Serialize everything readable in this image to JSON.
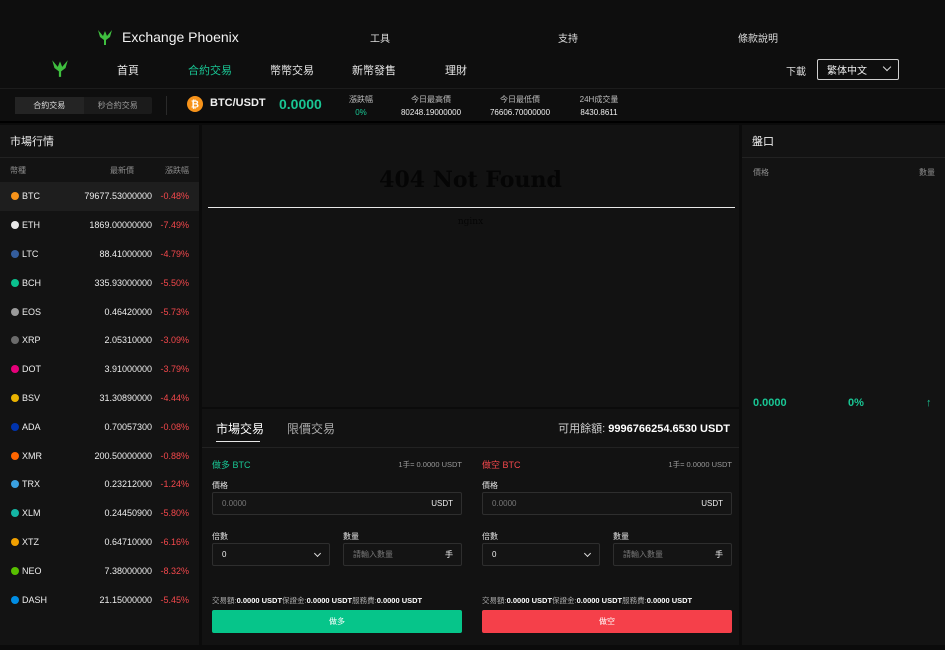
{
  "header": {
    "brand": "Exchange Phoenix",
    "top_links": [
      "工具",
      "支持",
      "條款說明"
    ],
    "nav": [
      "首頁",
      "合約交易",
      "幣幣交易",
      "新幣發售",
      "理財"
    ],
    "active_nav": "合約交易",
    "download": "下載",
    "language": "繁体中文"
  },
  "ticker": {
    "mode_tabs": [
      "合約交易",
      "秒合約交易"
    ],
    "pair": "BTC/USDT",
    "price": "0.0000",
    "change_label": "漲跌幅",
    "change_value": "0%",
    "high_label": "今日最高價",
    "high_value": "80248.19000000",
    "low_label": "今日最低價",
    "low_value": "76606.70000000",
    "vol_label": "24H成交量",
    "vol_value": "8430.8611"
  },
  "market": {
    "title": "市場行情",
    "col_coin": "幣種",
    "col_price": "最新價",
    "col_change": "漲跌幅",
    "rows": [
      {
        "sym": "BTC",
        "price": "79677.53000000",
        "change": "-0.48%",
        "color": "#f7931a"
      },
      {
        "sym": "ETH",
        "price": "1869.00000000",
        "change": "-7.49%",
        "color": "#e8e8e8"
      },
      {
        "sym": "LTC",
        "price": "88.41000000",
        "change": "-4.79%",
        "color": "#345d9d"
      },
      {
        "sym": "BCH",
        "price": "335.93000000",
        "change": "-5.50%",
        "color": "#0ac18e"
      },
      {
        "sym": "EOS",
        "price": "0.46420000",
        "change": "-5.73%",
        "color": "#9a9a9a"
      },
      {
        "sym": "XRP",
        "price": "2.05310000",
        "change": "-3.09%",
        "color": "#6b6b6b"
      },
      {
        "sym": "DOT",
        "price": "3.91000000",
        "change": "-3.79%",
        "color": "#e6007a"
      },
      {
        "sym": "BSV",
        "price": "31.30890000",
        "change": "-4.44%",
        "color": "#eab300"
      },
      {
        "sym": "ADA",
        "price": "0.70057300",
        "change": "-0.08%",
        "color": "#0033ad"
      },
      {
        "sym": "XMR",
        "price": "200.50000000",
        "change": "-0.88%",
        "color": "#ff6600"
      },
      {
        "sym": "TRX",
        "price": "0.23212000",
        "change": "-1.24%",
        "color": "#3aa0e0"
      },
      {
        "sym": "XLM",
        "price": "0.24450900",
        "change": "-5.80%",
        "color": "#14b6a4"
      },
      {
        "sym": "XTZ",
        "price": "0.64710000",
        "change": "-6.16%",
        "color": "#f0a000"
      },
      {
        "sym": "NEO",
        "price": "7.38000000",
        "change": "-8.32%",
        "color": "#58bf00"
      },
      {
        "sym": "DASH",
        "price": "21.15000000",
        "change": "-5.45%",
        "color": "#008de4"
      }
    ]
  },
  "chart_area": {
    "error_title": "404 Not Found",
    "error_sub": "nginx"
  },
  "order": {
    "tabs": [
      "市場交易",
      "限價交易"
    ],
    "available_label": "可用餘額:",
    "available_value": "9996766254.6530 USDT",
    "buy": {
      "side": "做多 BTC",
      "unit_info": "1手= 0.0000 USDT",
      "price_label": "價格",
      "price_placeholder": "0.0000",
      "price_suffix": "USDT",
      "lev_label": "倍數",
      "lev_value": "0",
      "qty_label": "數量",
      "qty_placeholder": "請輸入數量",
      "qty_suffix": "手",
      "totals": [
        "交易額:",
        "0.0000 USDT",
        "保證金:",
        "0.0000 USDT",
        "服務費:",
        "0.0000 USDT"
      ],
      "button": "做多"
    },
    "sell": {
      "side": "做空 BTC",
      "unit_info": "1手= 0.0000 USDT",
      "price_label": "價格",
      "price_placeholder": "0.0000",
      "price_suffix": "USDT",
      "lev_label": "倍數",
      "lev_value": "0",
      "qty_label": "數量",
      "qty_placeholder": "請輸入數量",
      "qty_suffix": "手",
      "totals": [
        "交易額:",
        "0.0000 USDT",
        "保證金:",
        "0.0000 USDT",
        "服務費:",
        "0.0000 USDT"
      ],
      "button": "做空"
    }
  },
  "orderbook": {
    "title": "盤口",
    "col_price": "價格",
    "col_qty": "數量",
    "mid_price": "0.0000",
    "mid_change": "0%",
    "mid_arrow": "↑"
  },
  "colors": {
    "green": "#19c694",
    "red": "#f4484c",
    "buy": "#06c58a",
    "sell": "#f5404a"
  }
}
